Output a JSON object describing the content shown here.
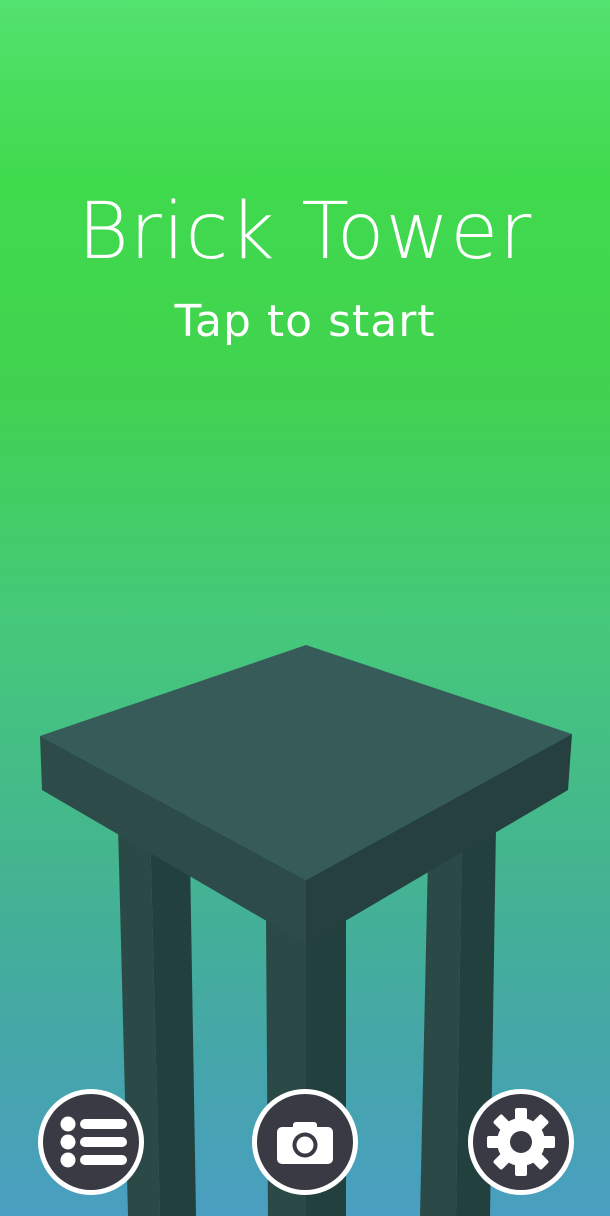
{
  "game": {
    "title": "Brick Tower",
    "subtitle": "Tap to start"
  },
  "buttons": [
    {
      "id": "leaderboard",
      "icon": "list-icon"
    },
    {
      "id": "screenshot",
      "icon": "camera-icon"
    },
    {
      "id": "settings",
      "icon": "gear-icon"
    }
  ],
  "colors": {
    "sky_top": "#53e26f",
    "sky_mid": "#40da4d",
    "sky_bottom": "#4a9ec1",
    "tower_top": "#375b58",
    "tower_front_left": "#2d4c49",
    "tower_front_right": "#25403e",
    "button_fill": "#3a3a44",
    "button_ring": "#ffffff"
  }
}
